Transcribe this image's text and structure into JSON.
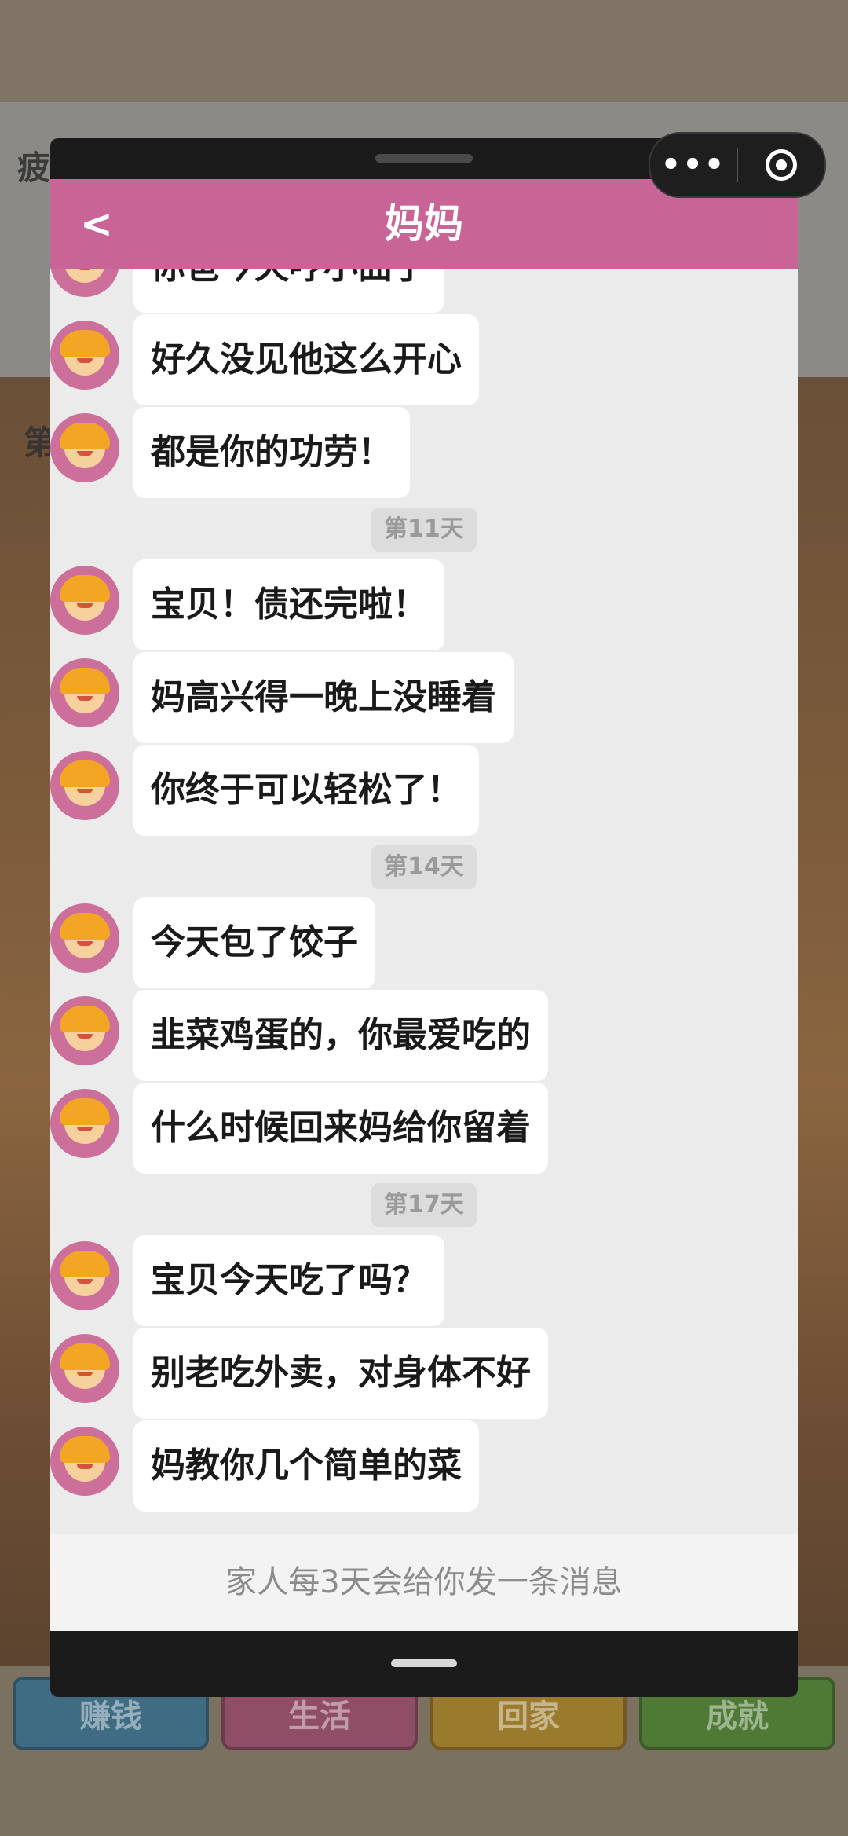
{
  "background": {
    "peek_left": "疲",
    "peek_mid": "第",
    "nav": [
      "赚钱",
      "生活",
      "回家",
      "成就"
    ]
  },
  "capsule": {
    "menu": "•••"
  },
  "header": {
    "back": "<",
    "title": "妈妈"
  },
  "messages": [
    {
      "text": "你爸今天哼小曲了"
    },
    {
      "text": "好久没见他这么开心"
    },
    {
      "text": "都是你的功劳！"
    },
    {
      "day": "第11天"
    },
    {
      "text": "宝贝！债还完啦！"
    },
    {
      "text": "妈高兴得一晚上没睡着"
    },
    {
      "text": "你终于可以轻松了！"
    },
    {
      "day": "第14天"
    },
    {
      "text": "今天包了饺子"
    },
    {
      "text": "韭菜鸡蛋的，你最爱吃的"
    },
    {
      "text": "什么时候回来妈给你留着"
    },
    {
      "day": "第17天"
    },
    {
      "text": "宝贝今天吃了吗？"
    },
    {
      "text": "别老吃外卖，对身体不好"
    },
    {
      "text": "妈教你几个简单的菜"
    }
  ],
  "footer": {
    "note": "家人每3天会给你发一条消息"
  },
  "colors": {
    "accent": "#c96596",
    "avatar_bg": "#cc6f9b",
    "chat_bg": "#ebebeb"
  }
}
